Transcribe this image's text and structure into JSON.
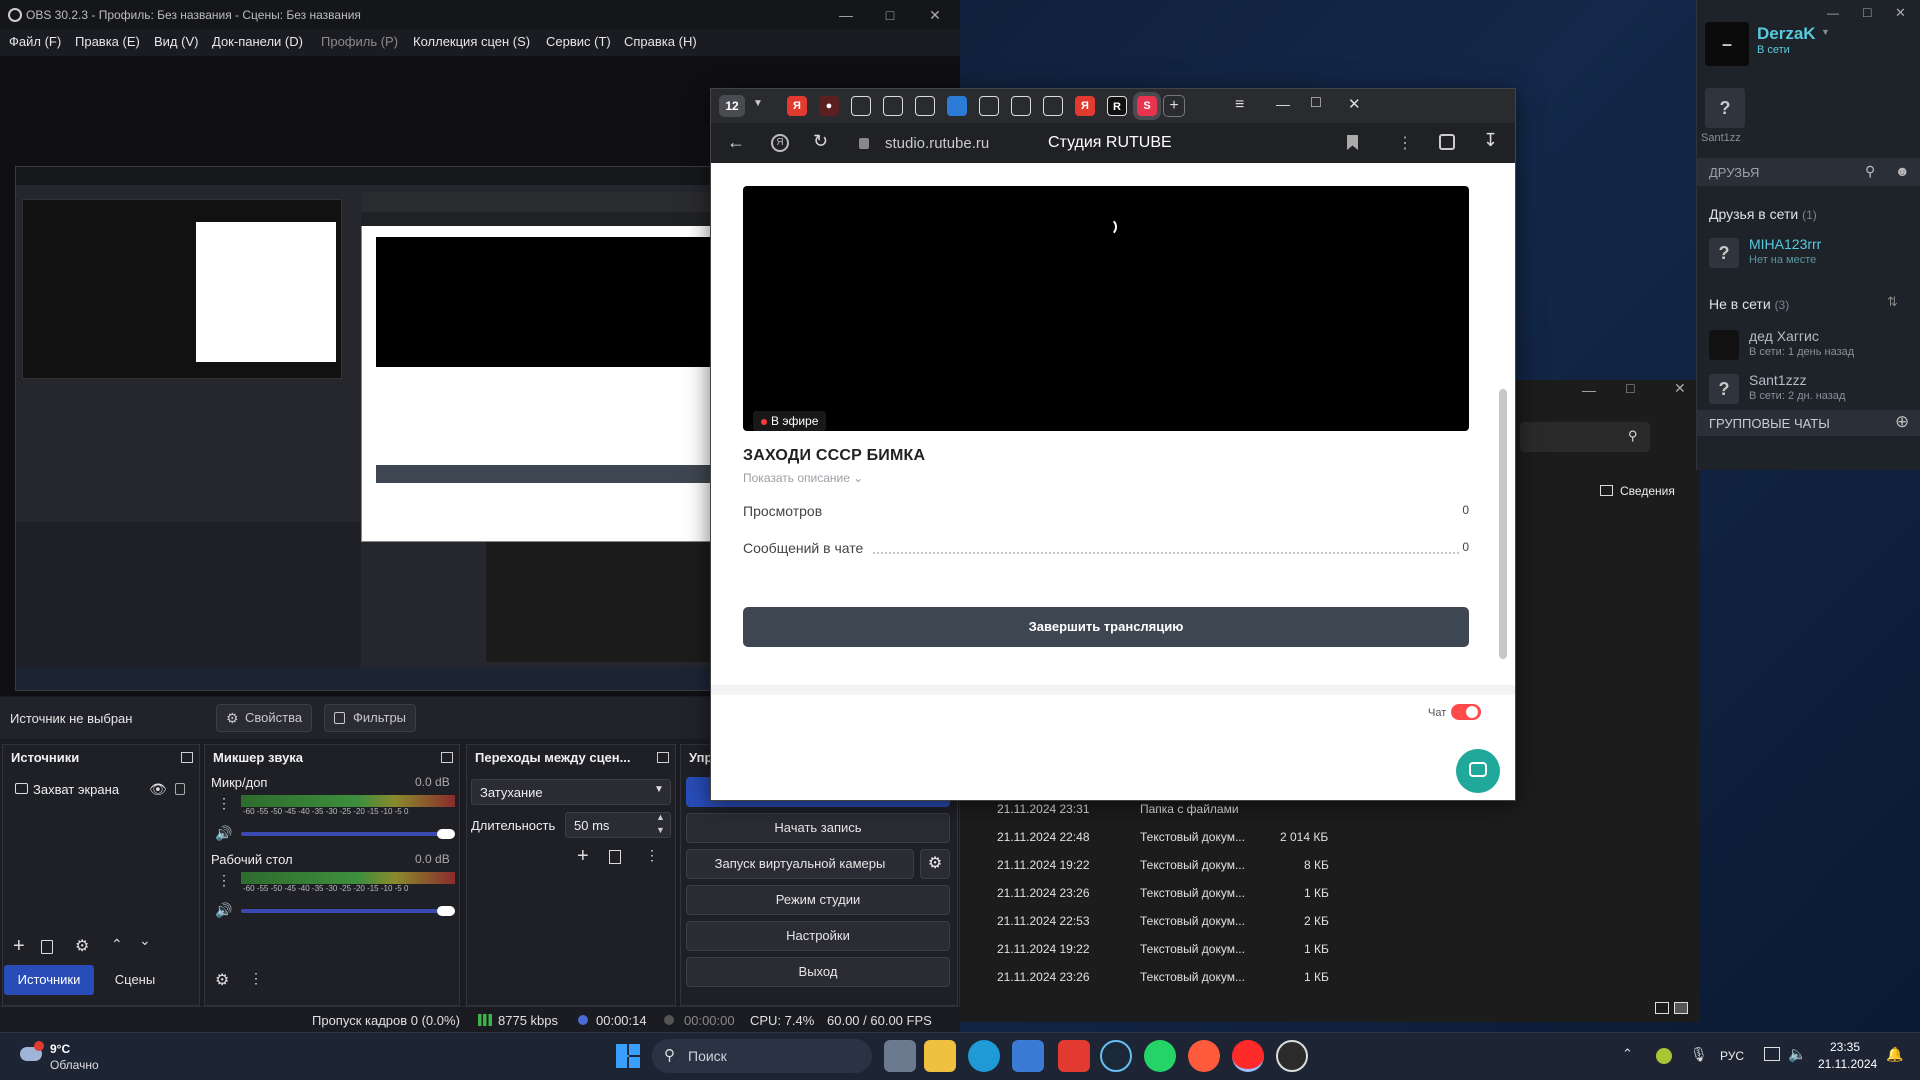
{
  "obs": {
    "title": "OBS 30.2.3 - Профиль: Без названия - Сцены: Без названия",
    "menu": [
      "Файл (F)",
      "Правка (E)",
      "Вид (V)",
      "Док-панели (D)",
      "Профиль (P)",
      "Коллекция сцен (S)",
      "Сервис (T)",
      "Справка (H)"
    ],
    "source_not_selected": "Источник не выбран",
    "properties_label": "Свойства",
    "filters_label": "Фильтры",
    "sources": {
      "title": "Источники",
      "items": [
        "Захват экрана"
      ]
    },
    "mixer": {
      "title": "Микшер звука",
      "channels": [
        {
          "name": "Микр/доп",
          "db": "0.0 dB"
        },
        {
          "name": "Рабочий стол",
          "db": "0.0 dB"
        }
      ],
      "scale": "-60 -55 -50 -45 -40 -35 -30 -25 -20 -15 -10 -5 0"
    },
    "transitions": {
      "title": "Переходы между сцен...",
      "selected": "Затухание",
      "duration_label": "Длительность",
      "duration_value": "50 ms"
    },
    "controls": {
      "title": "Упр",
      "buttons": [
        "Начать запись",
        "Запуск виртуальной камеры",
        "Режим студии",
        "Настройки",
        "Выход"
      ]
    },
    "tabs": {
      "sources": "Источники",
      "scenes": "Сцены"
    },
    "status": {
      "dropped": "Пропуск кадров 0 (0.0%)",
      "bitrate": "8775 kbps",
      "stream_time": "00:00:14",
      "rec_time": "00:00:00",
      "cpu": "CPU: 7.4%",
      "fps": "60.00 / 60.00 FPS"
    }
  },
  "browser": {
    "tab_count": "12",
    "url": "studio.rutube.ru",
    "page_title": "Студия RUTUBE",
    "live_badge": "В эфире",
    "stream_title": "ЗАХОДИ СССР БИМКА",
    "show_description": "Показать описание",
    "stats": [
      {
        "label": "Просмотров",
        "value": "0"
      },
      {
        "label": "Сообщений в чате",
        "value": "0"
      }
    ],
    "end_button": "Завершить трансляцию",
    "chat_label": "Чат"
  },
  "explorer": {
    "details_label": "Сведения",
    "files": [
      {
        "date": "21.11.2024 23:31",
        "type": "Папка с файлами",
        "size": ""
      },
      {
        "date": "21.11.2024 22:48",
        "type": "Текстовый докум...",
        "size": "2 014 КБ"
      },
      {
        "date": "21.11.2024 19:22",
        "type": "Текстовый докум...",
        "size": "8 КБ"
      },
      {
        "date": "21.11.2024 23:26",
        "type": "Текстовый докум...",
        "size": "1 КБ"
      },
      {
        "date": "21.11.2024 22:53",
        "type": "Текстовый докум...",
        "size": "2 КБ"
      },
      {
        "date": "21.11.2024 19:22",
        "type": "Текстовый докум...",
        "size": "1 КБ"
      },
      {
        "date": "21.11.2024 23:26",
        "type": "Текстовый докум...",
        "size": "1 КБ"
      }
    ]
  },
  "steam": {
    "user_name": "DerzaK",
    "user_status": "В сети",
    "friend_name_small": "Sant1zz",
    "friends_header": "ДРУЗЬЯ",
    "online_header": "Друзья в сети",
    "online_count": "(1)",
    "online": [
      {
        "name": "MIHA123rrr",
        "status": "Нет на месте"
      }
    ],
    "offline_header": "Не в сети",
    "offline_count": "(3)",
    "offline": [
      {
        "name": "дед Хаггис",
        "status": "В сети: 1 день назад"
      },
      {
        "name": "Sant1zzz",
        "status": "В сети: 2 дн. назад"
      }
    ],
    "group_chats": "ГРУППОВЫЕ ЧАТЫ"
  },
  "taskbar": {
    "weather_temp": "9°C",
    "weather_desc": "Облачно",
    "search_placeholder": "Поиск",
    "lang": "РУС",
    "time": "23:35",
    "date": "21.11.2024"
  },
  "colors": {
    "obs_bg": "#1b1c21",
    "rutube_live": "#ff3b3b",
    "end_button": "#3e4751",
    "steam_name": "#57cbde",
    "taskbar": "#1d2535"
  }
}
